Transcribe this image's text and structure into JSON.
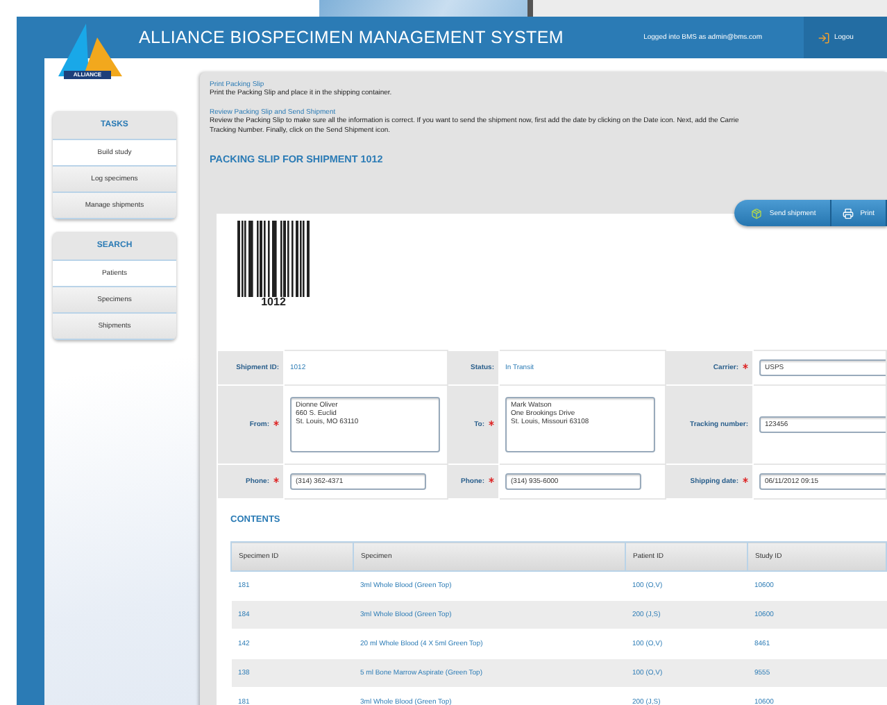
{
  "header": {
    "logo_text": "ALLIANCE",
    "title": "ALLIANCE BIOSPECIMEN MANAGEMENT SYSTEM",
    "user_text": "Logged into BMS as admin@bms.com",
    "logout_label": "Logou"
  },
  "sidebar": {
    "sections": [
      {
        "title": "TASKS",
        "items": [
          {
            "label": "Build study",
            "selected": true
          },
          {
            "label": "Log specimens",
            "selected": false
          },
          {
            "label": "Manage shipments",
            "selected": false
          }
        ]
      },
      {
        "title": "SEARCH",
        "items": [
          {
            "label": "Patients",
            "selected": true
          },
          {
            "label": "Specimens",
            "selected": false
          },
          {
            "label": "Shipments",
            "selected": false
          }
        ]
      }
    ]
  },
  "instructions": [
    {
      "heading": "Print Packing Slip",
      "text": "Print the Packing Slip and place it in the shipping container."
    },
    {
      "heading": "Review Packing Slip and Send Shipment",
      "text": "Review the Packing Slip to make sure all the information is correct. If you want to send the shipment now, first add the date by clicking on the Date icon. Next, add the Carrie",
      "text_2": "Tracking Number. Finally, click on the Send Shipment icon."
    }
  ],
  "packing_slip": {
    "title": "PACKING SLIP FOR SHIPMENT 1012",
    "actions": [
      {
        "label": "Send shipment",
        "kind": "send"
      },
      {
        "label": "Print",
        "kind": "print"
      }
    ],
    "barcode_number": "1012",
    "form_rows": [
      [
        {
          "label": "Shipment ID:",
          "required": false,
          "kind": "text",
          "value": "1012"
        },
        {
          "label": "Status:",
          "required": false,
          "kind": "text",
          "value": "In Transit"
        },
        {
          "label": "Carrier:",
          "required": true,
          "kind": "input",
          "value": "USPS"
        }
      ],
      [
        {
          "label": "From:",
          "required": true,
          "kind": "textarea",
          "value": "Dionne Oliver\n660 S. Euclid\nSt. Louis, MO 63110"
        },
        {
          "label": "To:",
          "required": true,
          "kind": "textarea",
          "value": "Mark Watson\nOne Brookings Drive\nSt. Louis, Missouri 63108"
        },
        {
          "label": "Tracking number:",
          "required": false,
          "kind": "input",
          "value": "123456"
        }
      ],
      [
        {
          "label": "Phone:",
          "required": true,
          "kind": "input",
          "value": "(314) 362-4371"
        },
        {
          "label": "Phone:",
          "required": true,
          "kind": "input",
          "value": "(314) 935-6000"
        },
        {
          "label": "Shipping date:",
          "required": true,
          "kind": "input",
          "value": "06/11/2012 09:15"
        }
      ]
    ]
  },
  "contents": {
    "title": "CONTENTS",
    "columns": [
      "Specimen ID",
      "Specimen",
      "Patient ID",
      "Study ID"
    ],
    "rows": [
      [
        "181",
        "3ml Whole Blood (Green Top)",
        "100 (O,V)",
        "10600"
      ],
      [
        "184",
        "3ml Whole Blood (Green Top)",
        "200 (J,S)",
        "10600"
      ],
      [
        "142",
        "20 ml Whole Blood (4 X 5ml Green Top)",
        "100 (O,V)",
        "8461"
      ],
      [
        "138",
        "5 ml Bone Marrow Aspirate (Green Top)",
        "100 (O,V)",
        "9555"
      ],
      [
        "181",
        "3ml Whole Blood (Green Top)",
        "200 (J,S)",
        "10600"
      ]
    ]
  }
}
